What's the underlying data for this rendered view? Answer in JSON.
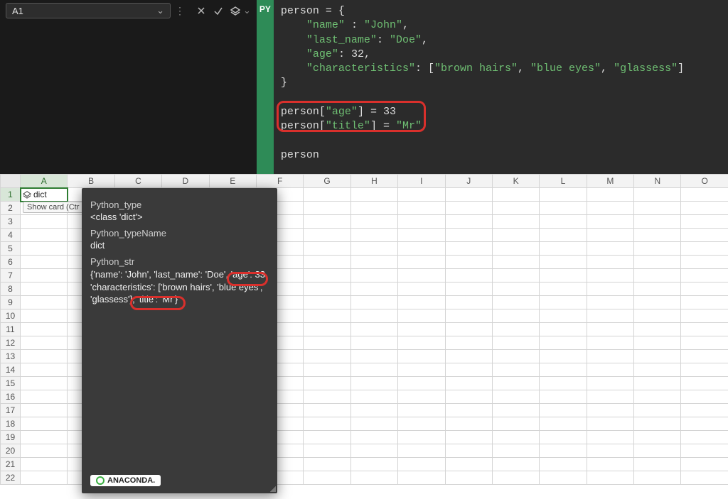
{
  "namebox": {
    "cell_ref": "A1"
  },
  "py_badge": "PY",
  "code": {
    "line1_a": "person = {",
    "line2_a": "    ",
    "line2_k": "\"name\"",
    "line2_b": " : ",
    "line2_v": "\"John\"",
    "line2_c": ",",
    "line3_a": "    ",
    "line3_k": "\"last_name\"",
    "line3_b": ": ",
    "line3_v": "\"Doe\"",
    "line3_c": ",",
    "line4_a": "    ",
    "line4_k": "\"age\"",
    "line4_b": ": ",
    "line4_v": "32",
    "line4_c": ",",
    "line5_a": "    ",
    "line5_k": "\"characteristics\"",
    "line5_b": ": [",
    "line5_v1": "\"brown hairs\"",
    "line5_s1": ", ",
    "line5_v2": "\"blue eyes\"",
    "line5_s2": ", ",
    "line5_v3": "\"glassess\"",
    "line5_c": "]",
    "line6_a": "}",
    "line8_a": "person[",
    "line8_k": "\"age\"",
    "line8_b": "] = ",
    "line8_v": "33",
    "line9_a": "person[",
    "line9_k": "\"title\"",
    "line9_b": "] = ",
    "line9_v": "\"Mr\"",
    "line11_a": "person"
  },
  "columns": [
    "A",
    "B",
    "C",
    "D",
    "E",
    "F",
    "G",
    "H",
    "I",
    "J",
    "K",
    "L",
    "M",
    "N",
    "O"
  ],
  "rows": [
    "1",
    "2",
    "3",
    "4",
    "5",
    "6",
    "7",
    "8",
    "9",
    "10",
    "11",
    "12",
    "13",
    "14",
    "15",
    "16",
    "17",
    "18",
    "19",
    "20",
    "21",
    "22"
  ],
  "cell_A1_label": "dict",
  "showcard_label": "Show card (Ctr",
  "card": {
    "h1": "Python_type",
    "v1": "<class 'dict'>",
    "h2": "Python_typeName",
    "v2": "dict",
    "h3": "Python_str",
    "pystr_pre1": "{'name': 'John', 'last_name': 'Doe', ",
    "pystr_hl1": "'age': 33,",
    "pystr_pre2": "'characteristics': ['brown hairs', 'blue eyes',",
    "pystr_pre3": "'glassess'], ",
    "pystr_hl2": "'title': 'Mr'}",
    "anaconda": "ANACONDA."
  }
}
